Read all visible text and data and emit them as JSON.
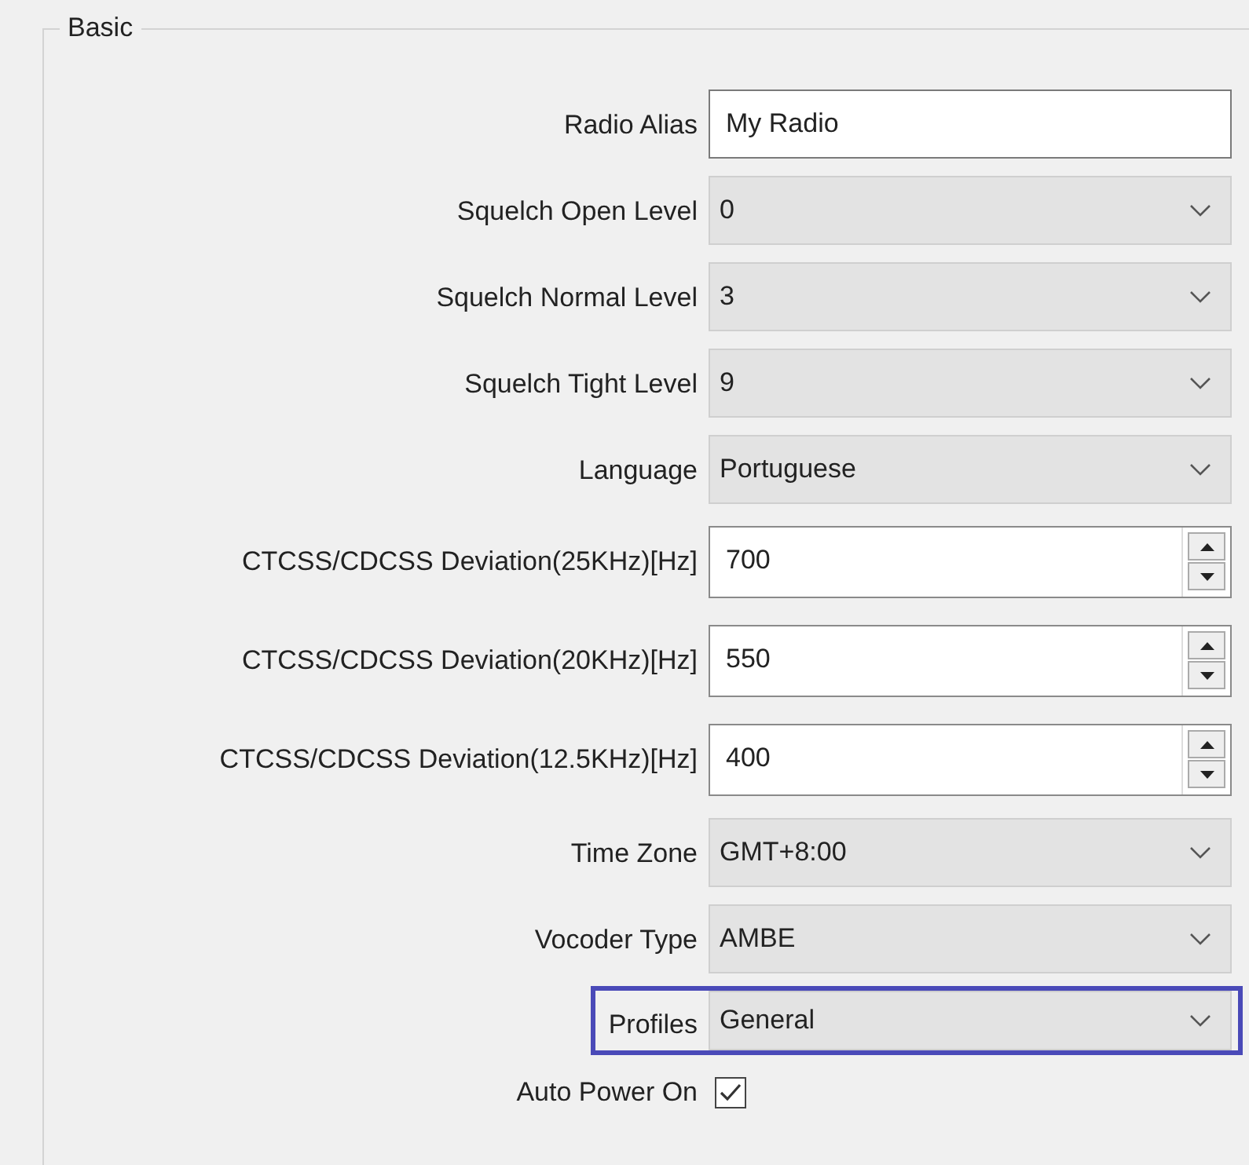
{
  "group": {
    "title": "Basic"
  },
  "rows": [
    {
      "kind": "text",
      "label": "Radio Alias",
      "value": "My Radio",
      "highlighted": false
    },
    {
      "kind": "combo",
      "label": "Squelch Open Level",
      "value": "0",
      "highlighted": false
    },
    {
      "kind": "combo",
      "label": "Squelch Normal Level",
      "value": "3",
      "highlighted": false
    },
    {
      "kind": "combo",
      "label": "Squelch Tight Level",
      "value": "9",
      "highlighted": false
    },
    {
      "kind": "combo",
      "label": "Language",
      "value": "Portuguese",
      "highlighted": false
    },
    {
      "kind": "spin",
      "label": "CTCSS/CDCSS Deviation(25KHz)[Hz]",
      "value": "700",
      "highlighted": false
    },
    {
      "kind": "spin",
      "label": "CTCSS/CDCSS Deviation(20KHz)[Hz]",
      "value": "550",
      "highlighted": false
    },
    {
      "kind": "spin",
      "label": "CTCSS/CDCSS Deviation(12.5KHz)[Hz]",
      "value": "400",
      "highlighted": false
    },
    {
      "kind": "combo",
      "label": "Time Zone",
      "value": "GMT+8:00",
      "highlighted": false
    },
    {
      "kind": "combo",
      "label": "Vocoder Type",
      "value": "AMBE",
      "highlighted": false
    },
    {
      "kind": "combo",
      "label": "Profiles",
      "value": "General",
      "highlighted": true
    },
    {
      "kind": "checkbox",
      "label": "Auto Power On",
      "checked": true,
      "highlighted": false
    }
  ]
}
